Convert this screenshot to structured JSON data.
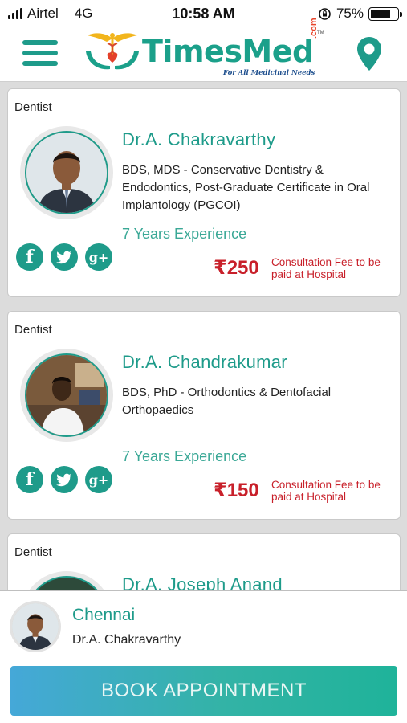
{
  "status_bar": {
    "carrier": "Airtel",
    "network": "4G",
    "time": "10:58 AM",
    "battery": "75%",
    "battery_level": 0.75
  },
  "header": {
    "logo_text": "TimesMed",
    "logo_domain": ".com",
    "logo_tm": "TM",
    "tagline": "For All Medicinal Needs",
    "menu_icon": "hamburger-menu-icon",
    "location_icon": "map-pin-icon"
  },
  "doctors": [
    {
      "specialty": "Dentist",
      "name": "Dr.A. Chakravarthy",
      "qualification": "BDS, MDS - Conservative Dentistry & Endodontics, Post-Graduate Certificate in Oral Implantology (PGCOI)",
      "experience": "7 Years Experience",
      "fee": "₹250",
      "fee_note": "Consultation Fee to be paid at Hospital"
    },
    {
      "specialty": "Dentist",
      "name": "Dr.A. Chandrakumar",
      "qualification": "BDS, PhD - Orthodontics & Dentofacial Orthopaedics",
      "experience": "7 Years Experience",
      "fee": "₹150",
      "fee_note": "Consultation Fee to be paid at Hospital"
    },
    {
      "specialty": "Dentist",
      "name": "Dr.A. Joseph Anand"
    }
  ],
  "social_icons": [
    "facebook-icon",
    "twitter-icon",
    "google-plus-icon"
  ],
  "social_labels": {
    "facebook": "f",
    "google": "g+"
  },
  "selected": {
    "city": "Chennai",
    "doctor": "Dr.A. Chakravarthy"
  },
  "book_button": "BOOK APPOINTMENT",
  "colors": {
    "brand_teal": "#1e9b8a",
    "fee_red": "#c8202a",
    "button_start": "#45a8d8",
    "button_end": "#1fb39a"
  }
}
